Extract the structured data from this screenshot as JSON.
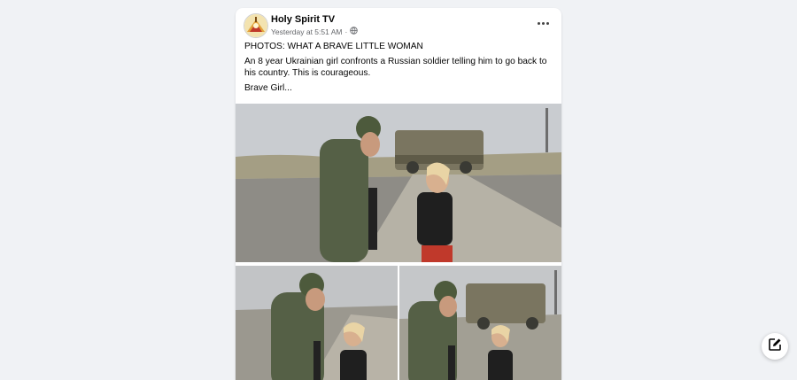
{
  "post": {
    "author": "Holy Spirit TV",
    "timestamp": "Yesterday at 5:51 AM",
    "separator": "·",
    "audience_icon": "globe-icon",
    "menu_icon": "more-horizontal-icon",
    "headline": "PHOTOS: WHAT A BRAVE LITTLE WOMAN",
    "body": "An 8 year Ukrainian girl confronts a Russian soldier telling him to go back to his country. This is courageous.",
    "tagline": "Brave Girl...",
    "photo_count": 3
  },
  "fab": {
    "icon": "compose-icon"
  },
  "colors": {
    "background": "#f0f2f5",
    "card": "#ffffff",
    "text": "#050505",
    "muted": "#65676b"
  }
}
